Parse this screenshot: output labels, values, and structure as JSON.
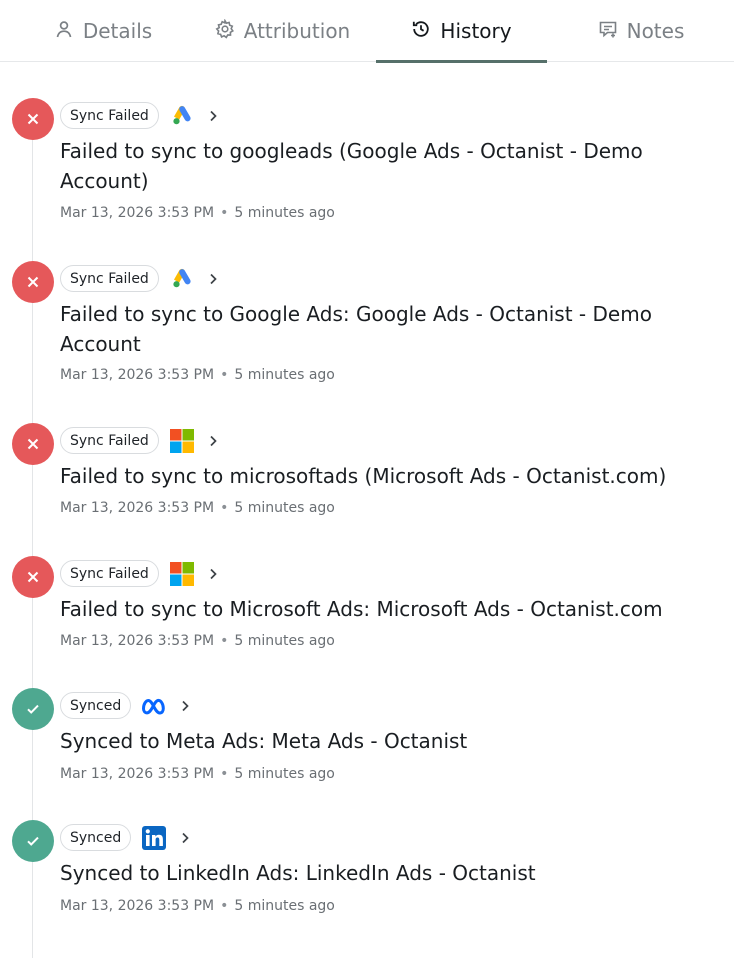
{
  "tabs": [
    {
      "label": "Details",
      "icon": "user-icon"
    },
    {
      "label": "Attribution",
      "icon": "gear-icon"
    },
    {
      "label": "History",
      "icon": "history-icon",
      "active": true
    },
    {
      "label": "Notes",
      "icon": "notes-icon"
    }
  ],
  "history": [
    {
      "status": "failed",
      "badge": "Sync Failed",
      "platform": "google-ads-icon",
      "title": "Failed to sync to googleads (Google Ads - Octanist - Demo Account)",
      "date": "Mar 13, 2026 3:53 PM",
      "relative": "5 minutes ago"
    },
    {
      "status": "failed",
      "badge": "Sync Failed",
      "platform": "google-ads-icon",
      "title": "Failed to sync to Google Ads: Google Ads - Octanist - Demo Account",
      "date": "Mar 13, 2026 3:53 PM",
      "relative": "5 minutes ago"
    },
    {
      "status": "failed",
      "badge": "Sync Failed",
      "platform": "microsoft-icon",
      "title": "Failed to sync to microsoftads (Microsoft Ads - Octanist.com)",
      "date": "Mar 13, 2026 3:53 PM",
      "relative": "5 minutes ago"
    },
    {
      "status": "failed",
      "badge": "Sync Failed",
      "platform": "microsoft-icon",
      "title": "Failed to sync to Microsoft Ads: Microsoft Ads - Octanist.com",
      "date": "Mar 13, 2026 3:53 PM",
      "relative": "5 minutes ago"
    },
    {
      "status": "success",
      "badge": "Synced",
      "platform": "meta-icon",
      "title": "Synced to Meta Ads: Meta Ads - Octanist",
      "date": "Mar 13, 2026 3:53 PM",
      "relative": "5 minutes ago"
    },
    {
      "status": "success",
      "badge": "Synced",
      "platform": "linkedin-icon",
      "title": "Synced to LinkedIn Ads: LinkedIn Ads - Octanist",
      "date": "Mar 13, 2026 3:53 PM",
      "relative": "5 minutes ago"
    }
  ],
  "colors": {
    "failed": "#e5585a",
    "success": "#4ea890",
    "active_tab_underline": "#56706a"
  }
}
